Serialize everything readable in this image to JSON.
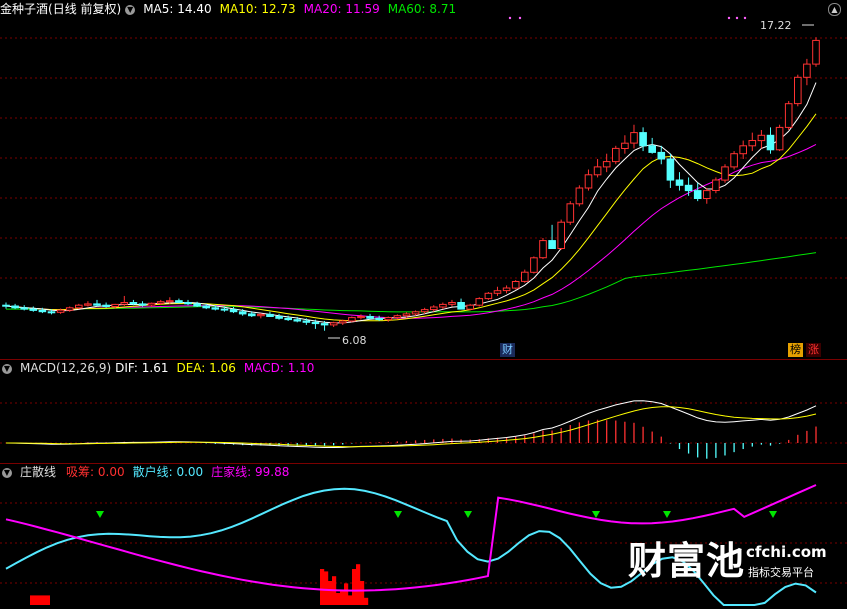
{
  "main": {
    "stock_name": "金种子酒",
    "period": "(日线 前复权)",
    "ma5": "MA5: 14.40",
    "ma10": "MA10: 12.73",
    "ma20": "MA20: 11.59",
    "ma60": "MA60: 8.71",
    "high_label": "17.22",
    "low_label": "6.08",
    "tag_cai": "财",
    "tag_bang": "榜",
    "tag_zhang": "涨"
  },
  "macd": {
    "title": "MACD(12,26,9)",
    "dif": "DIF: 1.61",
    "dea": "DEA: 1.06",
    "macd": "MACD: 1.10"
  },
  "zs": {
    "title": "庄散线",
    "xichou": "吸筹: 0.00",
    "sanhu": "散户线: 0.00",
    "zhuangjia": "庄家线: 99.88"
  },
  "watermark": {
    "brand": "财富池",
    "site": "cfchi.com",
    "slogan": "指标交易平台"
  },
  "colors": {
    "up": "#ff3232",
    "down": "#54ffff",
    "ma5": "#ffffff",
    "ma10": "#ffff00",
    "ma20": "#ff00ff",
    "ma60": "#00e600",
    "grid": "#7a0000",
    "sanhu_line": "#54e8ff",
    "zhuangjia_line": "#ff00ff",
    "xichou_bar": "#ff0000",
    "signal": "#00e600"
  },
  "chart_data": {
    "type": "candlestick",
    "price_range": [
      5.5,
      17.8
    ],
    "candles_ohlc": [
      [
        7.05,
        7.15,
        6.92,
        7.02
      ],
      [
        7.02,
        7.1,
        6.9,
        6.95
      ],
      [
        6.95,
        7.05,
        6.85,
        6.9
      ],
      [
        6.9,
        7.0,
        6.8,
        6.85
      ],
      [
        6.85,
        6.95,
        6.75,
        6.8
      ],
      [
        6.8,
        6.9,
        6.7,
        6.78
      ],
      [
        6.78,
        6.92,
        6.72,
        6.86
      ],
      [
        6.86,
        7.0,
        6.8,
        6.95
      ],
      [
        6.95,
        7.1,
        6.9,
        7.05
      ],
      [
        7.05,
        7.2,
        7.0,
        7.1
      ],
      [
        7.1,
        7.25,
        7.0,
        7.05
      ],
      [
        7.05,
        7.15,
        6.95,
        7.0
      ],
      [
        7.0,
        7.1,
        6.92,
        7.08
      ],
      [
        7.08,
        7.4,
        7.02,
        7.15
      ],
      [
        7.15,
        7.25,
        7.05,
        7.1
      ],
      [
        7.1,
        7.2,
        7.0,
        7.05
      ],
      [
        7.05,
        7.15,
        6.98,
        7.12
      ],
      [
        7.12,
        7.25,
        7.05,
        7.18
      ],
      [
        7.18,
        7.35,
        7.1,
        7.22
      ],
      [
        7.22,
        7.3,
        7.12,
        7.15
      ],
      [
        7.15,
        7.25,
        7.05,
        7.1
      ],
      [
        7.1,
        7.18,
        6.98,
        7.02
      ],
      [
        7.02,
        7.1,
        6.9,
        6.95
      ],
      [
        6.95,
        7.05,
        6.85,
        6.9
      ],
      [
        6.9,
        7.0,
        6.8,
        6.88
      ],
      [
        6.88,
        6.98,
        6.75,
        6.8
      ],
      [
        6.8,
        6.9,
        6.65,
        6.72
      ],
      [
        6.72,
        6.82,
        6.6,
        6.65
      ],
      [
        6.65,
        6.75,
        6.55,
        6.7
      ],
      [
        6.7,
        6.8,
        6.6,
        6.62
      ],
      [
        6.62,
        6.72,
        6.5,
        6.55
      ],
      [
        6.55,
        6.65,
        6.45,
        6.5
      ],
      [
        6.5,
        6.6,
        6.4,
        6.45
      ],
      [
        6.45,
        6.55,
        6.3,
        6.4
      ],
      [
        6.4,
        6.5,
        6.15,
        6.35
      ],
      [
        6.35,
        6.45,
        6.08,
        6.3
      ],
      [
        6.3,
        6.42,
        6.22,
        6.38
      ],
      [
        6.38,
        6.5,
        6.3,
        6.45
      ],
      [
        6.45,
        6.62,
        6.4,
        6.58
      ],
      [
        6.58,
        6.7,
        6.5,
        6.62
      ],
      [
        6.62,
        6.72,
        6.52,
        6.55
      ],
      [
        6.55,
        6.65,
        6.45,
        6.5
      ],
      [
        6.5,
        6.62,
        6.42,
        6.58
      ],
      [
        6.58,
        6.7,
        6.5,
        6.65
      ],
      [
        6.65,
        6.78,
        6.58,
        6.72
      ],
      [
        6.72,
        6.85,
        6.65,
        6.8
      ],
      [
        6.8,
        6.95,
        6.72,
        6.88
      ],
      [
        6.88,
        7.05,
        6.8,
        6.98
      ],
      [
        6.98,
        7.15,
        6.9,
        7.08
      ],
      [
        7.08,
        7.25,
        7.0,
        7.15
      ],
      [
        7.15,
        7.3,
        7.05,
        6.9
      ],
      [
        6.9,
        7.1,
        6.85,
        7.05
      ],
      [
        7.05,
        7.35,
        7.0,
        7.3
      ],
      [
        7.3,
        7.55,
        7.25,
        7.5
      ],
      [
        7.5,
        7.75,
        7.4,
        7.6
      ],
      [
        7.6,
        7.8,
        7.5,
        7.7
      ],
      [
        7.7,
        8.0,
        7.65,
        7.95
      ],
      [
        7.95,
        8.4,
        7.9,
        8.3
      ],
      [
        8.3,
        8.9,
        8.25,
        8.85
      ],
      [
        8.85,
        9.6,
        8.8,
        9.5
      ],
      [
        9.5,
        10.1,
        9.4,
        9.2
      ],
      [
        9.2,
        10.3,
        9.15,
        10.2
      ],
      [
        10.2,
        11.0,
        10.1,
        10.9
      ],
      [
        10.9,
        11.6,
        10.8,
        11.5
      ],
      [
        11.5,
        12.2,
        11.4,
        12.0
      ],
      [
        12.0,
        12.6,
        11.9,
        12.3
      ],
      [
        12.3,
        12.8,
        12.1,
        12.5
      ],
      [
        12.5,
        13.1,
        12.4,
        13.0
      ],
      [
        13.0,
        13.5,
        12.8,
        13.2
      ],
      [
        13.2,
        13.9,
        13.0,
        13.6
      ],
      [
        13.6,
        13.8,
        12.9,
        13.1
      ],
      [
        13.1,
        13.4,
        12.8,
        12.85
      ],
      [
        12.85,
        13.1,
        12.4,
        12.6
      ],
      [
        12.6,
        12.8,
        11.5,
        11.8
      ],
      [
        11.8,
        12.1,
        11.4,
        11.6
      ],
      [
        11.6,
        11.9,
        11.2,
        11.4
      ],
      [
        11.4,
        11.7,
        11.0,
        11.1
      ],
      [
        11.1,
        11.5,
        10.9,
        11.4
      ],
      [
        11.4,
        11.9,
        11.3,
        11.8
      ],
      [
        11.8,
        12.4,
        11.7,
        12.3
      ],
      [
        12.3,
        12.9,
        12.2,
        12.8
      ],
      [
        12.8,
        13.3,
        12.6,
        13.1
      ],
      [
        13.1,
        13.6,
        12.9,
        13.3
      ],
      [
        13.3,
        13.7,
        13.0,
        13.5
      ],
      [
        13.5,
        13.8,
        12.8,
        12.95
      ],
      [
        12.95,
        13.9,
        12.9,
        13.8
      ],
      [
        13.8,
        14.8,
        13.7,
        14.7
      ],
      [
        14.7,
        15.8,
        14.6,
        15.7
      ],
      [
        15.7,
        16.4,
        15.4,
        16.2
      ],
      [
        16.2,
        17.22,
        16.1,
        17.1
      ]
    ],
    "ma_series": [
      {
        "name": "MA5",
        "last": 14.4
      },
      {
        "name": "MA10",
        "last": 12.73
      },
      {
        "name": "MA20",
        "last": 11.59
      },
      {
        "name": "MA60",
        "last": 8.71
      }
    ],
    "macd_last": {
      "dif": 1.61,
      "dea": 1.06,
      "macd": 1.1
    },
    "zs_last": {
      "xichou": 0.0,
      "sanhu": 0.0,
      "zhuangjia": 99.88
    }
  }
}
